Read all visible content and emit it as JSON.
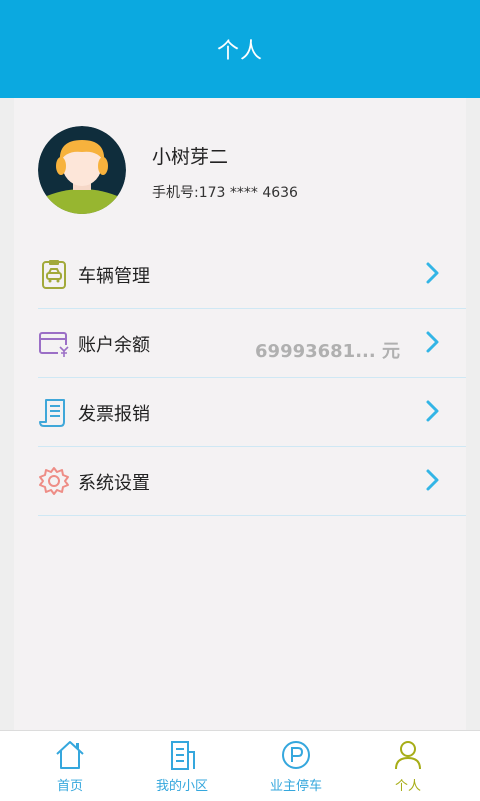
{
  "header": {
    "title": "个人"
  },
  "profile": {
    "name": "小树芽二",
    "phone": "手机号:173 **** 4636"
  },
  "menu": {
    "items": [
      {
        "label": "车辆管理"
      },
      {
        "label": "账户余额",
        "value": "69993681... 元"
      },
      {
        "label": "发票报销"
      },
      {
        "label": "系统设置"
      }
    ]
  },
  "tabbar": {
    "items": [
      {
        "label": "首页"
      },
      {
        "label": "我的小区"
      },
      {
        "label": "业主停车"
      },
      {
        "label": "个人"
      }
    ],
    "active_index": 3
  },
  "colors": {
    "accent": "#0ba9e0",
    "tab_active": "#a7ad17",
    "tab_inactive": "#35a7dd"
  }
}
